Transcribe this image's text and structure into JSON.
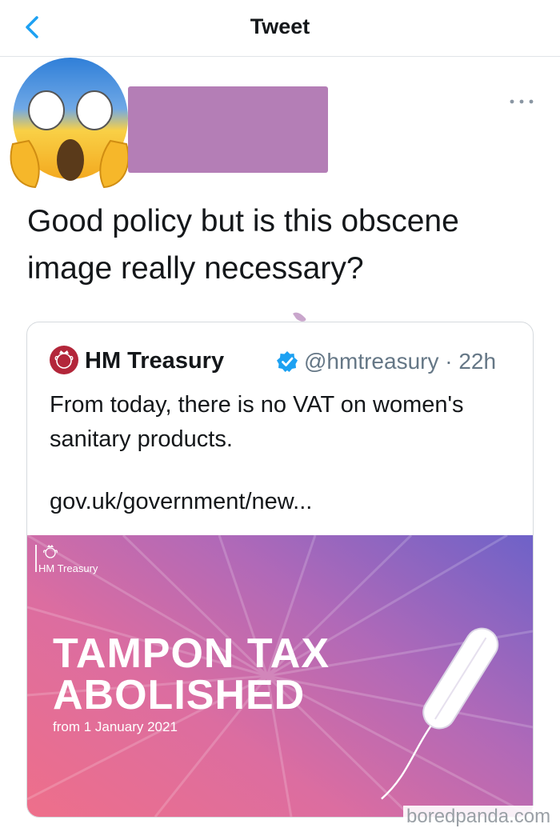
{
  "header": {
    "title": "Tweet",
    "back_icon": "chevron-left-icon"
  },
  "tweet": {
    "avatar_icon": "screaming-face-emoji",
    "more_icon": "ellipsis-icon",
    "text": "Good policy but is this obscene image really necessary?"
  },
  "quote": {
    "name": "HM Treasury",
    "handle_time": "@hmtreasury · 22h",
    "verified_icon": "verified-badge-icon",
    "text": "From today, there is no VAT on women's sanitary products.",
    "link": "gov.uk/government/new...",
    "banner": {
      "org": "HM Treasury",
      "headline_line1": "TAMPON TAX",
      "headline_line2": "ABOLISHED",
      "subtext": "from 1 January 2021"
    }
  },
  "watermark": "boredpanda.com",
  "colors": {
    "accent": "#1da1f2",
    "redaction": "#b47eb6",
    "banner_pink": "#ee6f8a",
    "banner_purple": "#6e62c8"
  }
}
